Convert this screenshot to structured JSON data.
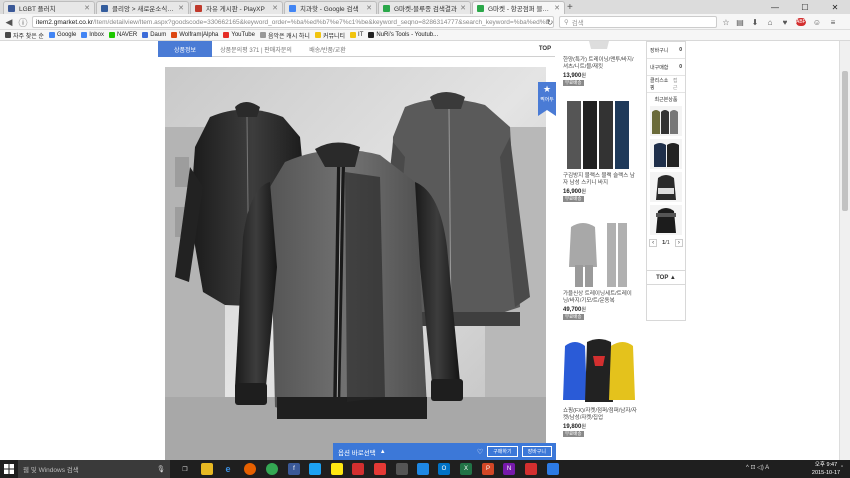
{
  "browser": {
    "tabs": [
      {
        "label": "LGBT 플러치",
        "color": "#3b5998",
        "active": false
      },
      {
        "label": "클리앙 > 새로운소식 1 ...",
        "color": "#345d9d",
        "active": false
      },
      {
        "label": "자유 게시판 - PlayXP",
        "color": "#c0392b",
        "active": false
      },
      {
        "label": "치과핫 - Google 검색",
        "color": "#4285f4",
        "active": false
      },
      {
        "label": "G마켓-블루종 검색결과",
        "color": "#2ba84a",
        "active": false
      },
      {
        "label": "G마켓 - 항공점퍼 블루종 ...",
        "color": "#2ba84a",
        "active": true
      }
    ],
    "window_controls": {
      "minimize": "—",
      "maximize": "☐",
      "close": "✕"
    },
    "url_host": "item2.gmarket.co.kr",
    "url_rest": "/Item/detailview/Item.aspx?goodscode=330662165&keyword_order=%ba%ed%b7%e7%c1%be&keyword_seqno=8286314777&search_keyword=%ba%ed%b",
    "search_placeholder": "검색",
    "bookmarks": [
      {
        "label": "자주 찾은 순",
        "color": "#4a4a4a"
      },
      {
        "label": "Google",
        "color": "#4285f4"
      },
      {
        "label": "Inbox",
        "color": "#4285f4"
      },
      {
        "label": "NAVER",
        "color": "#1ec800"
      },
      {
        "label": "Daum",
        "color": "#3b6bd8"
      },
      {
        "label": "Wolfram|Alpha",
        "color": "#dd4814"
      },
      {
        "label": "YouTube",
        "color": "#e52d27"
      },
      {
        "label": "음악은 캐시 하니",
        "color": "#999999"
      },
      {
        "label": "커뮤니티",
        "color": "#f1c40f"
      },
      {
        "label": "IT",
        "color": "#f1c40f"
      },
      {
        "label": "NuRi's Tools - Youtub...",
        "color": "#222222"
      }
    ]
  },
  "page": {
    "detail_tabs": {
      "info": "상품정보",
      "review": "상품문의평 371 | 판매자문의",
      "shipping": "배송/반품/교환",
      "top": "TOP"
    },
    "bookmark_ribbon": {
      "star": "★",
      "label": "찍어두"
    },
    "right_products": [
      {
        "text": "한양(특가) 트레이닝/맨투/바지/셔츠/니트/블/재킷",
        "price": "13,900",
        "unit": "원",
        "badge": "무료배송"
      },
      {
        "text": "구김방지 블랙스 블랙 슬랙스 남자 남성 스키니 바지",
        "price": "16,900",
        "unit": "원",
        "badge": "무료배송"
      },
      {
        "text": "가을신상 트레이닝세트/트레이닝/바지/기모/트/운동복",
        "price": "49,700",
        "unit": "원",
        "badge": "무료배송"
      },
      {
        "text": "쇼핑(FX)/자켓/점퍼/점퍼/남자/자켓/남성/자켓/집업",
        "price": "19,800",
        "unit": "원",
        "badge": "무료배송"
      }
    ],
    "sidebar": {
      "rows": [
        {
          "label": "장바구니",
          "count": "0"
        },
        {
          "label": "내구매함",
          "count": "0"
        },
        {
          "label": "클리스쇼핑",
          "count": "접근"
        }
      ],
      "recent_title": "최근본상품",
      "pager": {
        "prev": "‹",
        "current": "1",
        "sep": "/",
        "total": "1",
        "next": "›"
      },
      "top": "TOP ▲"
    },
    "option_bar": {
      "label": "옵션 바로선택",
      "chevron": "▲",
      "heart": "♡",
      "cart_button": "장바구니",
      "buy_button": "구매하기"
    }
  },
  "taskbar": {
    "search_placeholder": "웹 및 Windows 검색",
    "clock_time": "오후 9:47",
    "clock_date": "2015-10-17",
    "tray_text": "^  ⊡  ◁)  A"
  }
}
